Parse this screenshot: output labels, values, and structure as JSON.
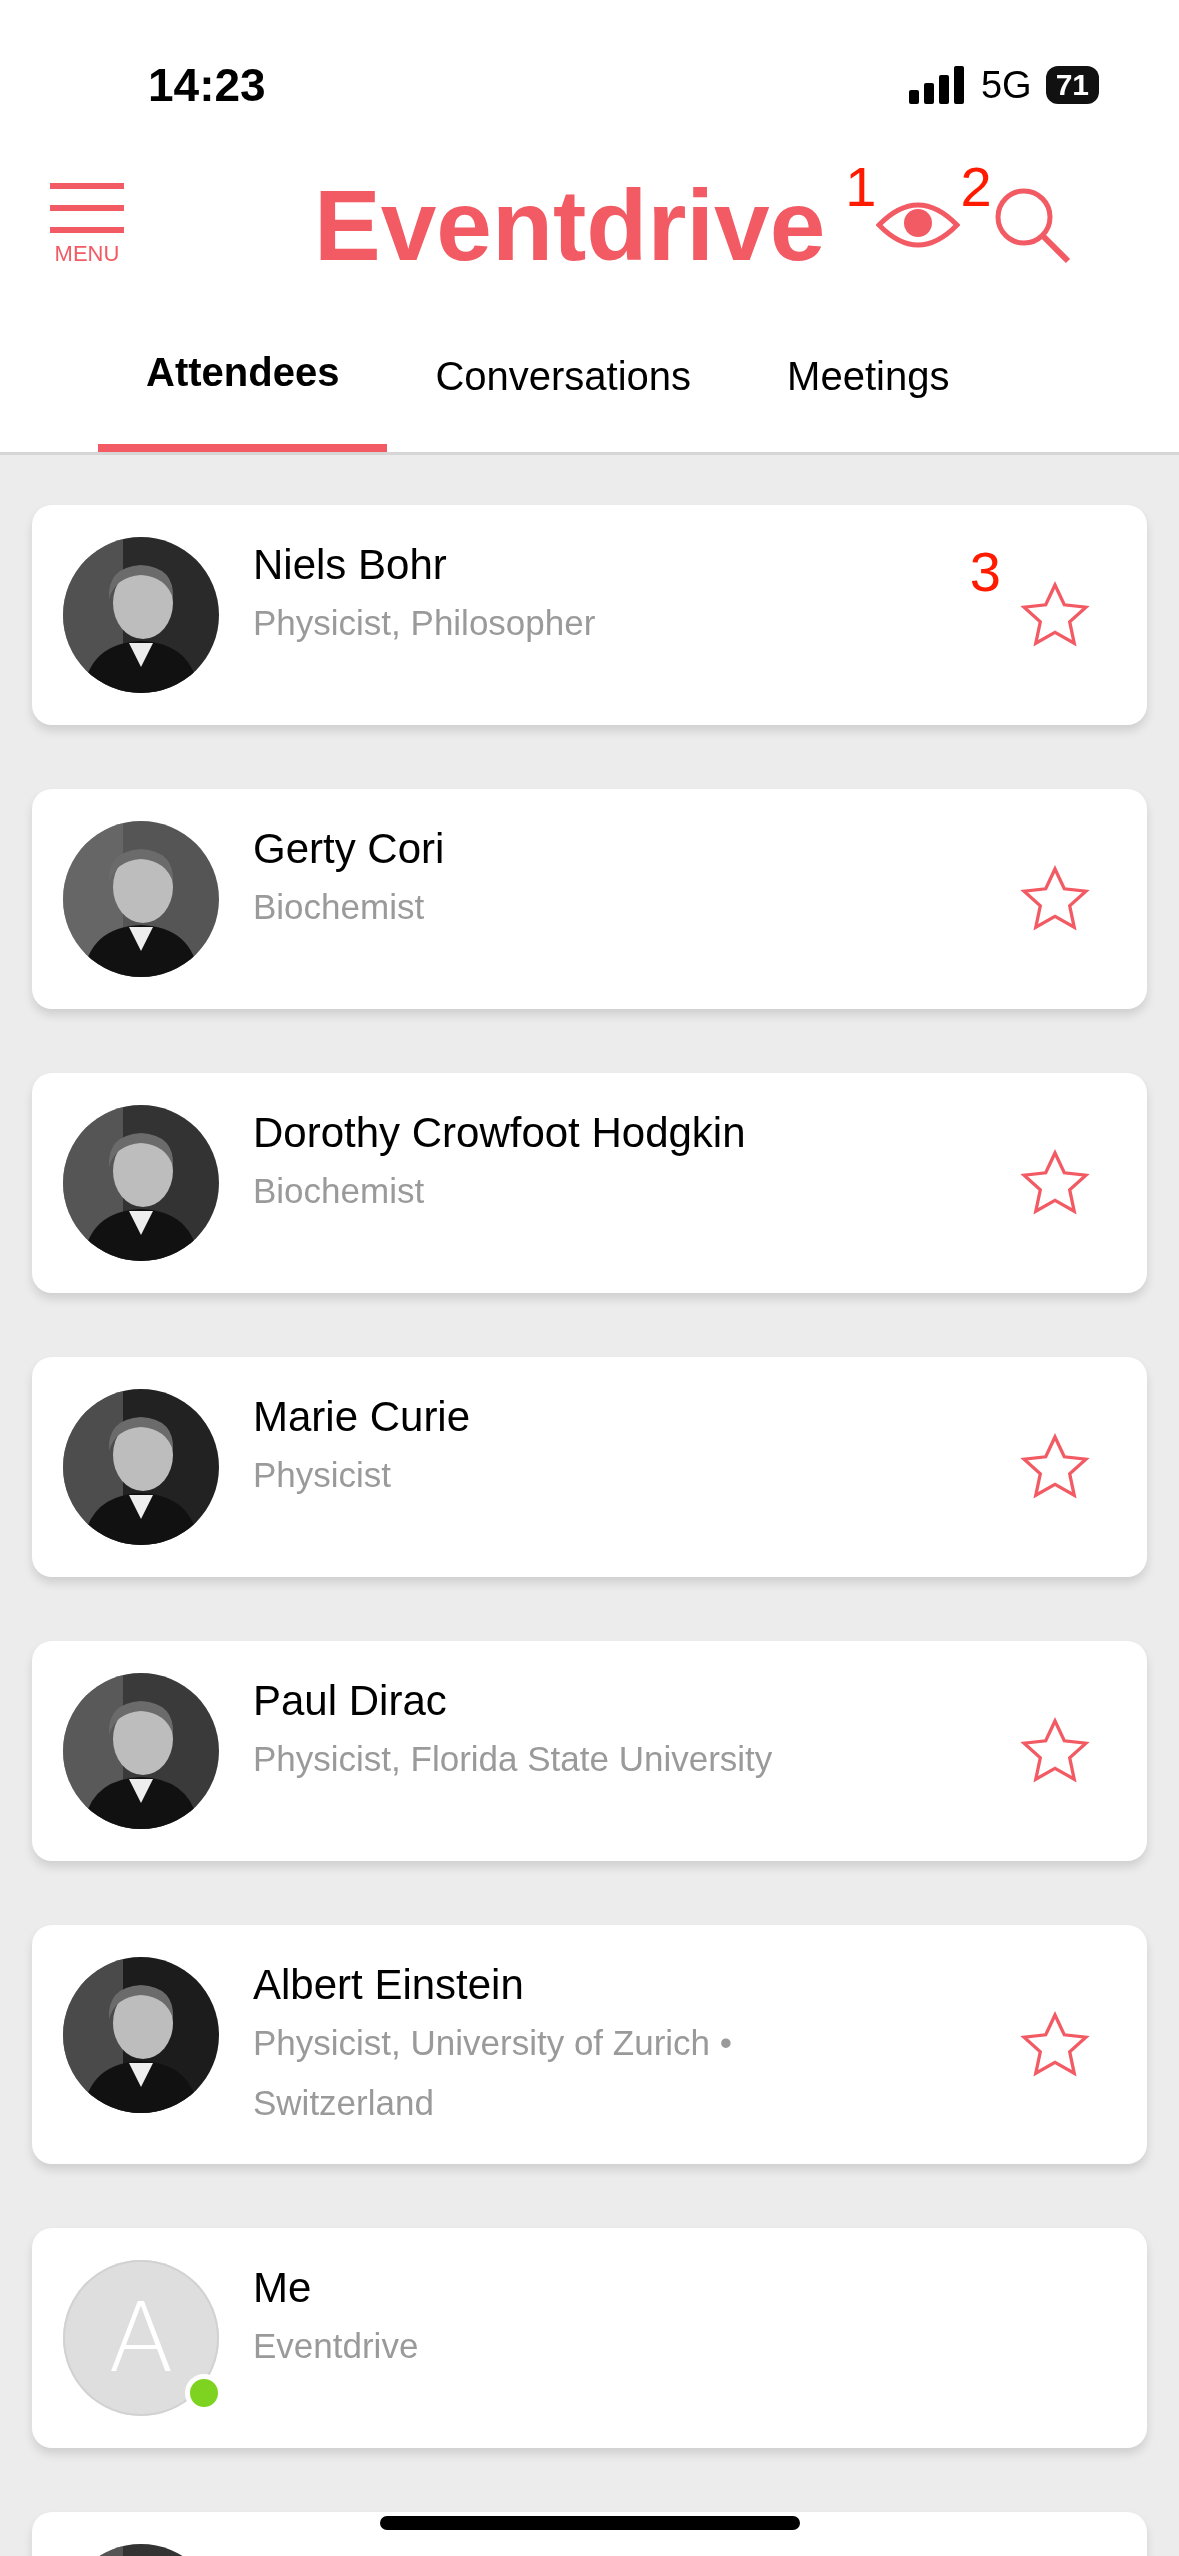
{
  "status_bar": {
    "time": "14:23",
    "network": "5G",
    "battery": "71"
  },
  "header": {
    "menu_label": "MENU",
    "logo": "Eventdrive",
    "eye_marker": "1",
    "search_marker": "2"
  },
  "tabs": [
    {
      "label": "Attendees",
      "selected": true
    },
    {
      "label": "Conversations",
      "selected": false
    },
    {
      "label": "Meetings",
      "selected": false
    }
  ],
  "attendees": [
    {
      "name": "Niels Bohr",
      "subtitle": "Physicist, Philosopher",
      "avatar": {
        "kind": "picture"
      },
      "starred": false,
      "marker": "3"
    },
    {
      "name": "Gerty Cori",
      "subtitle": "Biochemist",
      "avatar": {
        "kind": "picture"
      },
      "starred": false
    },
    {
      "name": "Dorothy Crowfoot Hodgkin",
      "subtitle": "Biochemist",
      "avatar": {
        "kind": "picture"
      },
      "starred": false
    },
    {
      "name": "Marie Curie",
      "subtitle": "Physicist",
      "avatar": {
        "kind": "picture"
      },
      "starred": false
    },
    {
      "name": "Paul Dirac",
      "subtitle": "Physicist, Florida State University",
      "avatar": {
        "kind": "picture"
      },
      "starred": false
    },
    {
      "name": "Albert Einstein",
      "subtitle": "Physicist, University of Zurich • Switzerland",
      "avatar": {
        "kind": "picture"
      },
      "starred": false
    },
    {
      "name": "Me",
      "subtitle": "Eventdrive",
      "avatar": {
        "kind": "initial",
        "initial": "A",
        "online": true
      }
    },
    {
      "avatar": {
        "kind": "picture"
      }
    }
  ]
}
